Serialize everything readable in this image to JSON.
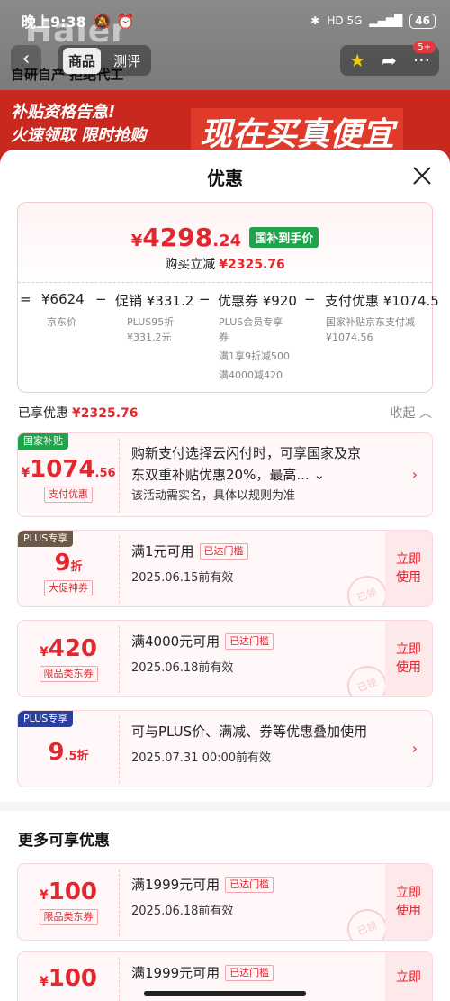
{
  "status_bar": {
    "time": "晚上9:38",
    "network": "HD 5G",
    "battery": "46"
  },
  "background": {
    "brand_logo": "Haier",
    "tagline": "自研自产 拒绝代工",
    "alert_line1": "补贴资格告急!",
    "alert_line2": "火速领取 限时抢购",
    "big_slogan": "现在买真便宜"
  },
  "nav": {
    "tabs": [
      "商品",
      "测评"
    ],
    "active_tab": 0,
    "badge": "5+"
  },
  "sheet": {
    "title": "优惠",
    "summary": {
      "currency": "¥",
      "price_int": "4298",
      "price_dec": ".24",
      "price_tag": "国补到手价",
      "reduce_label": "购买立减",
      "reduce_value": "¥2325.76",
      "breakdown": [
        {
          "op": "=",
          "main": "¥6624",
          "sub": [
            "京东价"
          ]
        },
        {
          "op": "−",
          "main": "促销 ¥331.2",
          "sub": [
            "PLUS95折",
            "¥331.2元"
          ]
        },
        {
          "op": "−",
          "main": "优惠券 ¥920",
          "sub": [
            "PLUS会员专享",
            "券",
            "满1享9折减500",
            "满4000减420"
          ]
        },
        {
          "op": "−",
          "main": "支付优惠 ¥1074.5",
          "sub": [
            "国家补贴京东支付减",
            "¥1074.56"
          ]
        }
      ]
    },
    "enjoyed_label": "已享优惠",
    "enjoyed_value": "¥2325.76",
    "collapse_label": "收起",
    "coupons": [
      {
        "corner": "国家补贴",
        "corner_color": "#1fa44a",
        "cur": "¥",
        "big": "1074",
        "small": ".56",
        "kind": "支付优惠",
        "desc1": "购新支付选择云闪付时，可享国家及京",
        "desc2": "东双重补贴优惠20%，最高...",
        "desc3": "该活动需实名，具体以规则为准"
      },
      {
        "corner": "PLUS专享",
        "corner_color": "#6b5a4a",
        "big": "9",
        "small": "折",
        "kind": "大促神券",
        "title": "满1元可用",
        "reached": "已达门槛",
        "expire": "2025.06.15前有效",
        "action_line1": "立即",
        "action_line2": "使用",
        "stamp": "已领"
      },
      {
        "cur": "¥",
        "big": "420",
        "kind": "限品类东券",
        "title": "满4000元可用",
        "reached": "已达门槛",
        "expire": "2025.06.18前有效",
        "action_line1": "立即",
        "action_line2": "使用",
        "stamp": "已领"
      },
      {
        "corner": "PLUS专享",
        "corner_color": "#2a3f9e",
        "big": "9",
        "small": ".5折",
        "title": "可与PLUS价、满减、券等优惠叠加使用",
        "expire": "2025.07.31 00:00前有效"
      }
    ],
    "more_title": "更多可享优惠",
    "more_coupons": [
      {
        "cur": "¥",
        "big": "100",
        "kind": "限品类东券",
        "title": "满1999元可用",
        "reached": "已达门槛",
        "expire": "2025.06.18前有效",
        "action_line1": "立即",
        "action_line2": "使用",
        "stamp": "已领"
      },
      {
        "cur": "¥",
        "big": "100",
        "title": "满1999元可用",
        "reached": "已达门槛",
        "action_line1": "立即"
      }
    ]
  }
}
